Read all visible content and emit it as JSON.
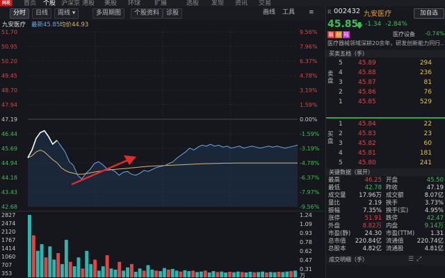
{
  "topnav": {
    "items": [
      "首页",
      "个股",
      "沪深京",
      "港股",
      "美股",
      "环球",
      "扩展",
      "选股",
      "发现",
      "资讯",
      "交易"
    ]
  },
  "toolbar": {
    "buttons": [
      "分时",
      "日线",
      "周线",
      "多周期图",
      "个股资料",
      "诊股"
    ],
    "right_links": [
      "画线",
      "工具",
      "≡"
    ]
  },
  "chart_header": {
    "name": "九安医疗",
    "latest_label": "最新45.85",
    "avg_label": "均价44.93"
  },
  "stock": {
    "prefix": "R",
    "code": "002432",
    "name": "九安医疗",
    "add_label": "加自选",
    "price": "45.85",
    "change": "-1.34",
    "change_pct": "-2.84%",
    "sector": "医疗设备",
    "sector_pct": "-0.74%",
    "desc": "医疗器械领域深耕20余年，研发创新能力同行...",
    "tags": [
      "融",
      "创",
      "陆"
    ],
    "tag_colors": [
      "#d83a3a",
      "#e07a1a",
      "#c03ac0"
    ]
  },
  "orderbook": {
    "title": "买卖五档（手）",
    "sell_label": "卖盘",
    "buy_label": "买盘",
    "sell": [
      {
        "lvl": "5",
        "price": "45.89",
        "vol": "294"
      },
      {
        "lvl": "4",
        "price": "45.88",
        "vol": "236"
      },
      {
        "lvl": "3",
        "price": "45.87",
        "vol": "81"
      },
      {
        "lvl": "2",
        "price": "45.86",
        "vol": "76"
      },
      {
        "lvl": "1",
        "price": "45.85",
        "vol": "529"
      }
    ],
    "buy": [
      {
        "lvl": "1",
        "price": "45.84",
        "vol": "22"
      },
      {
        "lvl": "2",
        "price": "45.83",
        "vol": "23"
      },
      {
        "lvl": "3",
        "price": "45.82",
        "vol": "60"
      },
      {
        "lvl": "4",
        "price": "45.81",
        "vol": "181"
      },
      {
        "lvl": "5",
        "price": "45.80",
        "vol": "241"
      }
    ]
  },
  "stats": {
    "title": "关键数据（展开）",
    "rows": [
      [
        "最高",
        "46.25",
        "red",
        "开盘",
        "45.50",
        "grn"
      ],
      [
        "最低",
        "42.78",
        "grn",
        "昨收",
        "47.19",
        "wht"
      ],
      [
        "成交量",
        "17.96万",
        "wht",
        "成交额",
        "8.07亿",
        "wht"
      ],
      [
        "量比",
        "2.19",
        "wht",
        "换手",
        "3.73%",
        "wht"
      ],
      [
        "振幅",
        "7.35%",
        "wht",
        "换手(实)",
        "4.95%",
        "wht"
      ],
      [
        "涨停",
        "51.91",
        "red",
        "跌停",
        "42.47",
        "grn"
      ],
      [
        "外盘",
        "8.82万",
        "red",
        "内盘",
        "9.14万",
        "grn"
      ],
      [
        "市盈(静)",
        "24.30",
        "wht",
        "市盈(TTM)",
        "1.31",
        "wht"
      ],
      [
        "总市值",
        "220.84亿",
        "wht",
        "流通值",
        "220.74亿",
        "wht"
      ],
      [
        "总股本",
        "4.82亿",
        "wht",
        "流通股",
        "4.81亿",
        "wht"
      ]
    ],
    "footer": "成交明细（手）"
  },
  "colors": {
    "up": "#e04444",
    "down": "#3fbf5a",
    "price_line": "#6fa9e8",
    "avg_line": "#d9b86b",
    "arrow": "#e02b2b"
  },
  "chart_data": {
    "type": "line",
    "title": "",
    "ylim": [
      42.68,
      51.7
    ],
    "prev_close": 47.19,
    "y_ticks_left": [
      "51.70",
      "50.95",
      "50.20",
      "49.45",
      "48.70",
      "47.94",
      "47.19",
      "46.44",
      "45.69",
      "44.94",
      "44.18",
      "43.43",
      "42.68"
    ],
    "y_ticks_right": [
      "9.56%",
      "7.96%",
      "6.37%",
      "4.78%",
      "3.19%",
      "1.59%",
      "0.00%",
      "-1.59%",
      "-3.19%",
      "-4.78%",
      "-6.37%",
      "-7.97%",
      "-9.56%"
    ],
    "series": [
      {
        "values": [
          45.2,
          45.6,
          46.2,
          46.5,
          46.6,
          46.3,
          45.9,
          46.1,
          45.8,
          45.5,
          45.0,
          44.8,
          44.3,
          44.1,
          44.4,
          44.6,
          44.9,
          45.0,
          44.85,
          44.65,
          44.6,
          44.5,
          44.3,
          44.45,
          44.5,
          44.35,
          44.3,
          44.4,
          44.55,
          44.5,
          44.6,
          44.7,
          44.75,
          44.8,
          44.9,
          45.0,
          45.2,
          45.35,
          45.5,
          45.7,
          45.6,
          45.75,
          45.85,
          45.8,
          45.9,
          45.8,
          45.85,
          45.75,
          45.8,
          45.7,
          45.75,
          45.8,
          45.7,
          45.75,
          45.8,
          45.75,
          45.7,
          45.75,
          45.8,
          45.75,
          45.8,
          45.75,
          45.7,
          45.75,
          45.8,
          45.85
        ]
      },
      {
        "values": [
          45.2,
          45.3,
          45.5,
          45.6,
          45.5,
          45.3,
          45.1,
          44.95,
          44.7,
          44.55,
          44.45,
          44.4,
          44.35,
          44.35,
          44.38,
          44.42,
          44.46,
          44.5,
          44.53,
          44.56,
          44.58,
          44.6,
          44.62,
          44.64,
          44.66,
          44.68,
          44.7,
          44.72,
          44.74,
          44.76,
          44.77,
          44.78,
          44.79,
          44.8,
          44.81,
          44.82,
          44.83,
          44.84,
          44.85,
          44.86,
          44.87,
          44.88,
          44.89,
          44.9,
          44.9,
          44.91,
          44.91,
          44.92,
          44.92,
          44.92,
          44.93,
          44.93,
          44.93,
          44.93,
          44.93,
          44.93,
          44.93,
          44.93,
          44.93,
          44.93,
          44.93,
          44.93,
          44.93,
          44.93,
          44.93,
          44.93
        ]
      }
    ]
  },
  "volume": {
    "left_ticks": [
      "2827",
      "2474",
      "2120",
      "1767",
      "1414",
      "1060",
      "707",
      "353"
    ],
    "right_ticks": [
      "1.24",
      "1.09",
      "0.93",
      "0.78",
      "0.62",
      "0.47",
      "0.31"
    ],
    "right_unit": "万",
    "values": [
      2827,
      1900,
      1200,
      1500,
      900,
      1400,
      800,
      1100,
      600,
      1700,
      700,
      500,
      900,
      400,
      1200,
      600,
      800,
      300,
      500,
      1000,
      400,
      350,
      700,
      300,
      450,
      600,
      250,
      400,
      300,
      550,
      350,
      300,
      280,
      420,
      350,
      380,
      300,
      260,
      320,
      280,
      300,
      240,
      260,
      300,
      220,
      280,
      240,
      260,
      220,
      250,
      230,
      260,
      240,
      220,
      250,
      230,
      240,
      260,
      220,
      240,
      230,
      250,
      240,
      260,
      280,
      300
    ]
  }
}
